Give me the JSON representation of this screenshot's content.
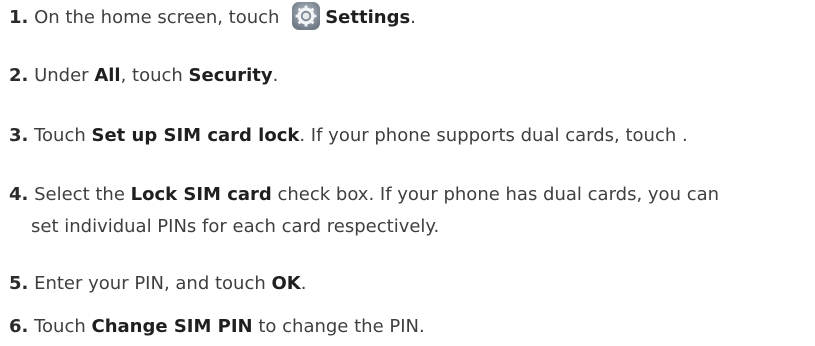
{
  "steps": [
    {
      "number": "1.",
      "text_before": " On the home screen, touch ",
      "icon": "settings-gear-icon",
      "bold": "Settings",
      "text_after": "."
    },
    {
      "number": "2.",
      "text_a": " Under ",
      "bold_a": "All",
      "text_b": ", touch ",
      "bold_b": "Security",
      "text_c": "."
    },
    {
      "number": "3.",
      "text_a": " Touch ",
      "bold_a": "Set up SIM card lock",
      "text_b": ". If your phone supports dual cards, touch ."
    },
    {
      "number": "4.",
      "text_a": " Select the ",
      "bold_a": "Lock SIM card",
      "text_b": " check box. If your phone has dual cards, you can",
      "text_c": "set individual PINs for each card respectively."
    },
    {
      "number": "5.",
      "text_a": " Enter your PIN, and touch ",
      "bold_a": "OK",
      "text_b": "."
    },
    {
      "number": "6.",
      "text_a": " Touch ",
      "bold_a": "Change SIM PIN",
      "text_b": " to change the PIN."
    }
  ]
}
